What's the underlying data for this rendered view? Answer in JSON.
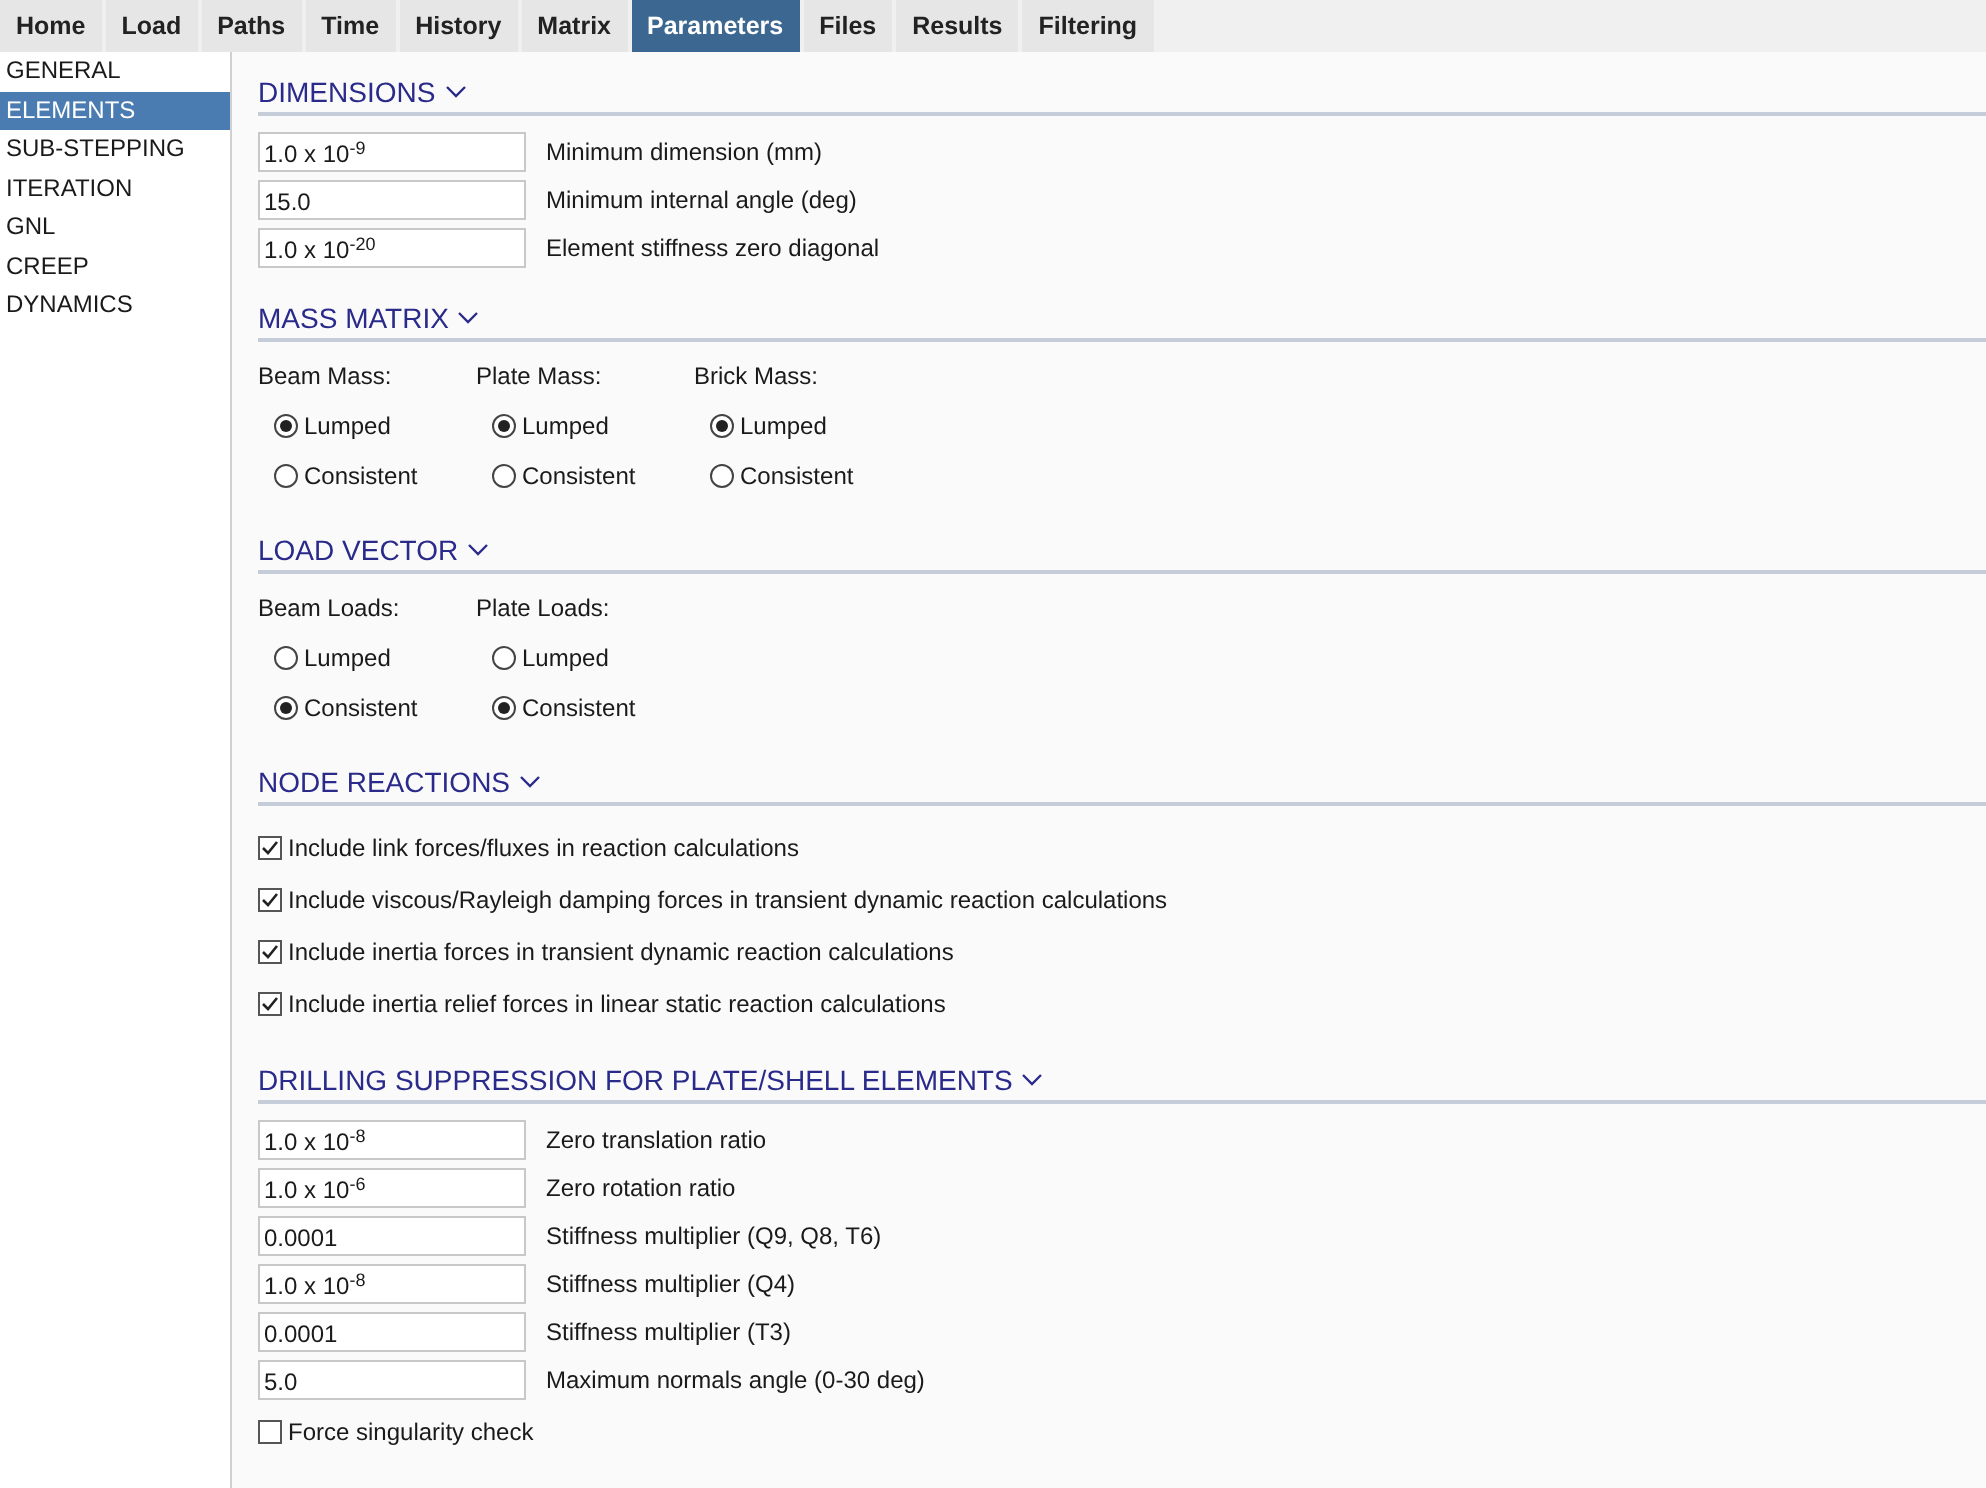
{
  "tabs": [
    {
      "label": "Home",
      "selected": false
    },
    {
      "label": "Load",
      "selected": false
    },
    {
      "label": "Paths",
      "selected": false
    },
    {
      "label": "Time",
      "selected": false
    },
    {
      "label": "History",
      "selected": false
    },
    {
      "label": "Matrix",
      "selected": false
    },
    {
      "label": "Parameters",
      "selected": true
    },
    {
      "label": "Files",
      "selected": false
    },
    {
      "label": "Results",
      "selected": false
    },
    {
      "label": "Filtering",
      "selected": false
    }
  ],
  "sidebar": {
    "items": [
      {
        "label": "GENERAL",
        "selected": false
      },
      {
        "label": "ELEMENTS",
        "selected": true
      },
      {
        "label": "SUB-STEPPING",
        "selected": false
      },
      {
        "label": "ITERATION",
        "selected": false
      },
      {
        "label": "GNL",
        "selected": false
      },
      {
        "label": "CREEP",
        "selected": false
      },
      {
        "label": "DYNAMICS",
        "selected": false
      }
    ]
  },
  "sections": [
    {
      "title": "DIMENSIONS",
      "expanded": true,
      "fields": [
        {
          "value": "1.0 x 10$^{-9}$",
          "label": "Minimum dimension (mm)"
        },
        {
          "value": "15.0",
          "label": "Minimum internal angle (deg)"
        },
        {
          "value": "1.0 x 10$^{-20}$",
          "label": "Element stiffness zero diagonal"
        }
      ]
    },
    {
      "title": "MASS MATRIX",
      "expanded": true,
      "radio_groups": [
        {
          "label": "Beam Mass:",
          "options": [
            {
              "label": "Lumped",
              "selected": true
            },
            {
              "label": "Consistent",
              "selected": false
            }
          ]
        },
        {
          "label": "Plate Mass:",
          "options": [
            {
              "label": "Lumped",
              "selected": true
            },
            {
              "label": "Consistent",
              "selected": false
            }
          ]
        },
        {
          "label": "Brick Mass:",
          "options": [
            {
              "label": "Lumped",
              "selected": true
            },
            {
              "label": "Consistent",
              "selected": false
            }
          ]
        }
      ]
    },
    {
      "title": "LOAD VECTOR",
      "expanded": true,
      "radio_groups": [
        {
          "label": "Beam Loads:",
          "options": [
            {
              "label": "Lumped",
              "selected": false
            },
            {
              "label": "Consistent",
              "selected": true
            }
          ]
        },
        {
          "label": "Plate Loads:",
          "options": [
            {
              "label": "Lumped",
              "selected": false
            },
            {
              "label": "Consistent",
              "selected": true
            }
          ]
        }
      ]
    },
    {
      "title": "NODE REACTIONS",
      "expanded": true,
      "checkboxes": [
        {
          "label": "Include link forces/fluxes in reaction calculations",
          "checked": true
        },
        {
          "label": "Include viscous/Rayleigh damping forces in transient dynamic reaction calculations",
          "checked": true
        },
        {
          "label": "Include inertia forces in transient dynamic reaction calculations",
          "checked": true
        },
        {
          "label": "Include inertia relief forces in linear static reaction calculations",
          "checked": true
        }
      ]
    },
    {
      "title": "DRILLING SUPPRESSION FOR PLATE/SHELL ELEMENTS",
      "expanded": true,
      "fields": [
        {
          "value": "1.0 x 10$^{-8}$",
          "label": "Zero translation ratio"
        },
        {
          "value": "1.0 x 10$^{-6}$",
          "label": "Zero rotation ratio"
        },
        {
          "value": "0.0001",
          "label": "Stiffness multiplier (Q9, Q8, T6)"
        },
        {
          "value": "1.0 x 10$^{-8}$",
          "label": "Stiffness multiplier (Q4)"
        },
        {
          "value": "0.0001",
          "label": "Stiffness multiplier (T3)"
        },
        {
          "value": "5.0",
          "label": "Maximum normals angle (0-30 deg)"
        }
      ],
      "checkboxes": [
        {
          "label": "Force singularity check",
          "checked": false
        }
      ]
    }
  ]
}
